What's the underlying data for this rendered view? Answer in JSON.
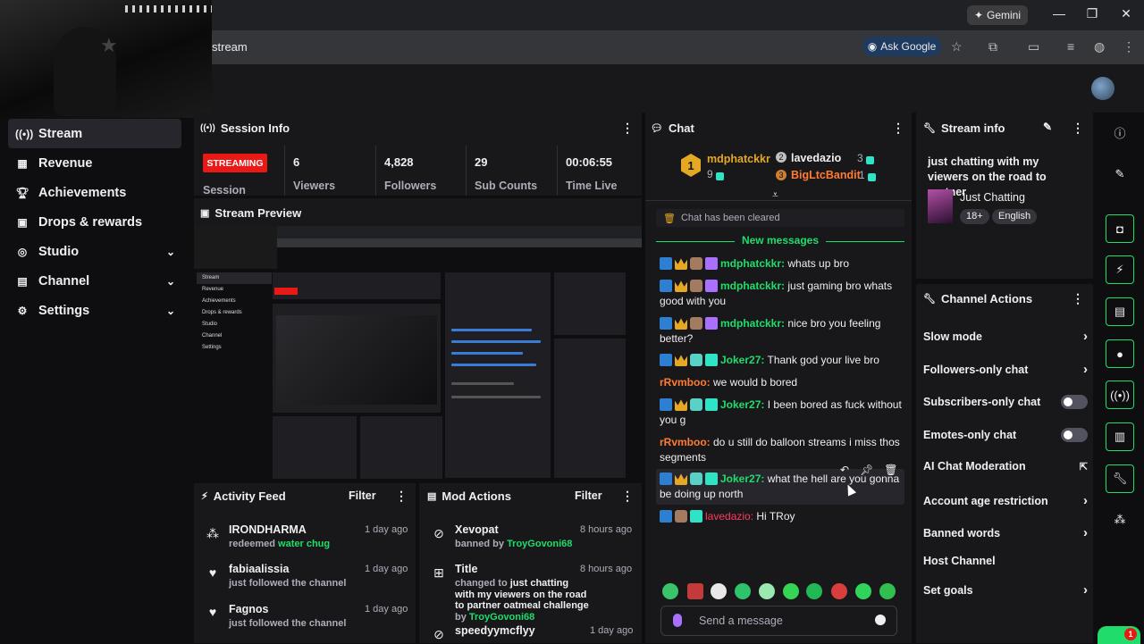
{
  "browser": {
    "gemini_label": "Gemini",
    "url_text": "stream",
    "ask_google_label": "Ask Google",
    "window_controls": [
      "—",
      "❐",
      "✕"
    ]
  },
  "nav": {
    "items": [
      {
        "label": "Stream",
        "icon": "broadcast-icon"
      },
      {
        "label": "Revenue",
        "icon": "revenue-icon"
      },
      {
        "label": "Achievements",
        "icon": "trophy-icon"
      },
      {
        "label": "Drops & rewards",
        "icon": "gift-icon"
      },
      {
        "label": "Studio",
        "icon": "studio-icon"
      },
      {
        "label": "Channel",
        "icon": "channel-icon"
      },
      {
        "label": "Settings",
        "icon": "gear-icon"
      }
    ]
  },
  "session": {
    "title": "Session Info",
    "status": "STREAMING",
    "status_label": "Session",
    "stats": [
      {
        "value": "6",
        "label": "Viewers"
      },
      {
        "value": "4,828",
        "label": "Followers"
      },
      {
        "value": "29",
        "label": "Sub Counts"
      },
      {
        "value": "00:06:55",
        "label": "Time Live"
      }
    ]
  },
  "preview": {
    "title": "Stream Preview"
  },
  "chat": {
    "title": "Chat",
    "leaders": [
      {
        "rank": "1",
        "name": "mdphatckkr",
        "count": "9"
      },
      {
        "rank": "2",
        "name": "lavedazio",
        "count": "3"
      },
      {
        "rank": "3",
        "name": "BigLtcBandit",
        "count": "1"
      }
    ],
    "cleared_notice": "Chat has been cleared",
    "new_messages_label": "New messages",
    "messages": [
      {
        "user": "mdphatckkr:",
        "text": " whats up bro"
      },
      {
        "user": "mdphatckkr:",
        "text": " just gaming bro whats good with you"
      },
      {
        "user": "mdphatckkr:",
        "text": " nice bro you feeling better?"
      },
      {
        "user": "Joker27:",
        "text": " Thank god your live bro"
      },
      {
        "user": "rRvmboo:",
        "text": " we would b bored"
      },
      {
        "user": "Joker27:",
        "text": " I been bored as fuck without you g"
      },
      {
        "user": "rRvmboo:",
        "text": " do u still do balloon streams i miss thos segments"
      },
      {
        "user": "Joker27:",
        "text": " what the hell are you gonna be doing up north"
      },
      {
        "user": "lavedazio:",
        "text": " Hi TRoy"
      }
    ],
    "input_placeholder": "Send a message"
  },
  "stream_info": {
    "title": "Stream info",
    "stream_title": "just chatting with my viewers on the road to partner",
    "category": "Just Chatting",
    "tags": [
      "18+",
      "English"
    ]
  },
  "channel_actions": {
    "title": "Channel Actions",
    "items": [
      {
        "label": "Slow mode",
        "control": "chevron"
      },
      {
        "label": "Followers-only chat",
        "control": "chevron"
      },
      {
        "label": "Subscribers-only chat",
        "control": "toggle"
      },
      {
        "label": "Emotes-only chat",
        "control": "toggle"
      },
      {
        "label": "AI Chat Moderation",
        "control": "external"
      },
      {
        "label": "Account age restriction",
        "control": "chevron"
      },
      {
        "label": "Banned words",
        "control": "chevron"
      },
      {
        "label": "Host Channel",
        "control": "none"
      },
      {
        "label": "Set goals",
        "control": "chevron"
      }
    ]
  },
  "activity_feed": {
    "title": "Activity Feed",
    "filter_label": "Filter",
    "items": [
      {
        "name": "IRONDHARMA",
        "action": "redeemed ",
        "highlight": "water chug",
        "time": "1 day ago"
      },
      {
        "name": "fabiaalissia",
        "action": "just followed the channel",
        "highlight": "",
        "time": "1 day ago"
      },
      {
        "name": "Fagnos",
        "action": "just followed the channel",
        "highlight": "",
        "time": "1 day ago"
      }
    ]
  },
  "mod_actions": {
    "title": "Mod Actions",
    "filter_label": "Filter",
    "items": [
      {
        "name": "Xevopat",
        "action": "banned by ",
        "by": "TroyGovoni68",
        "time": "8 hours ago"
      },
      {
        "name": "Title",
        "action": "changed to ",
        "detail": "just chatting with my viewers on the road to partner oatmeal challenge",
        "by_prefix": " by ",
        "by": "TroyGovoni68",
        "time": "8 hours ago"
      },
      {
        "name": "speedyymcflyy",
        "action": "",
        "by": "",
        "time": "1 day ago"
      }
    ]
  },
  "colors": {
    "accent_green": "#1fdd6b",
    "live_red": "#e91916",
    "panel_bg": "#18181b",
    "page_bg": "#0e0e10"
  }
}
